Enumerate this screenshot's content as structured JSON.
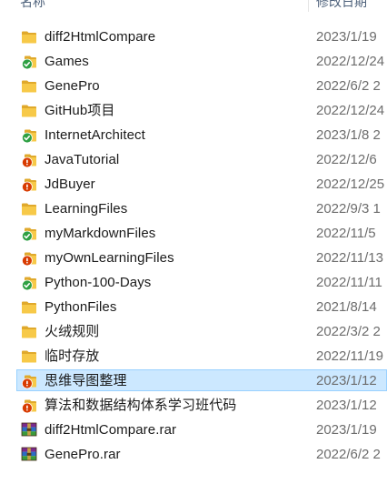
{
  "columns": {
    "name": "名称",
    "modified": "修改日期"
  },
  "colors": {
    "folder": "#f7c948",
    "sync_ok": "#2ea043",
    "sync_error": "#d83b01",
    "selection_bg": "#cce8ff",
    "selection_border": "#99d1ff"
  },
  "files": [
    {
      "name": "diff2HtmlCompare",
      "date": "2023/1/19",
      "icon": "folder-icon",
      "selected": false
    },
    {
      "name": "Games",
      "date": "2022/12/24",
      "icon": "folder-synced-icon",
      "selected": false
    },
    {
      "name": "GenePro",
      "date": "2022/6/2 2",
      "icon": "folder-icon",
      "selected": false
    },
    {
      "name": "GitHub项目",
      "date": "2022/12/24",
      "icon": "folder-icon",
      "selected": false
    },
    {
      "name": "InternetArchitect",
      "date": "2023/1/8 2",
      "icon": "folder-synced-icon",
      "selected": false
    },
    {
      "name": "JavaTutorial",
      "date": "2022/12/6",
      "icon": "folder-conflict-icon",
      "selected": false
    },
    {
      "name": "JdBuyer",
      "date": "2022/12/25",
      "icon": "folder-conflict-icon",
      "selected": false
    },
    {
      "name": "LearningFiles",
      "date": "2022/9/3 1",
      "icon": "folder-icon",
      "selected": false
    },
    {
      "name": "myMarkdownFiles",
      "date": "2022/11/5",
      "icon": "folder-synced-icon",
      "selected": false
    },
    {
      "name": "myOwnLearningFiles",
      "date": "2022/11/13",
      "icon": "folder-conflict-icon",
      "selected": false
    },
    {
      "name": "Python-100-Days",
      "date": "2022/11/11",
      "icon": "folder-synced-icon",
      "selected": false
    },
    {
      "name": "PythonFiles",
      "date": "2021/8/14",
      "icon": "folder-icon",
      "selected": false
    },
    {
      "name": "火绒规则",
      "date": "2022/3/2 2",
      "icon": "folder-icon",
      "selected": false
    },
    {
      "name": "临时存放",
      "date": "2022/11/19",
      "icon": "folder-icon",
      "selected": false
    },
    {
      "name": "思维导图整理",
      "date": "2023/1/12",
      "icon": "folder-conflict-icon",
      "selected": true
    },
    {
      "name": "算法和数据结构体系学习班代码",
      "date": "2023/1/12",
      "icon": "folder-conflict-icon",
      "selected": false
    },
    {
      "name": "diff2HtmlCompare.rar",
      "date": "2023/1/19",
      "icon": "rar-archive-icon",
      "selected": false
    },
    {
      "name": "GenePro.rar",
      "date": "2022/6/2 2",
      "icon": "rar-archive-icon",
      "selected": false
    }
  ]
}
